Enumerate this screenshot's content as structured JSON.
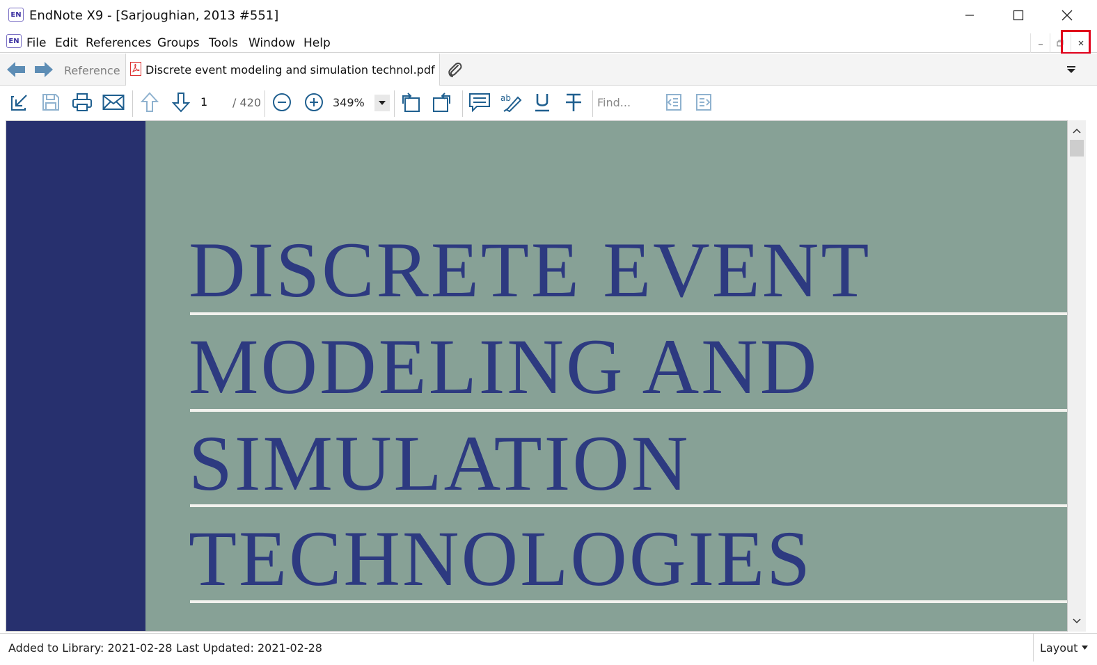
{
  "window": {
    "title": "EndNote X9 - [Sarjoughian, 2013 #551]",
    "app_icon_text": "EN"
  },
  "menu": {
    "items": [
      "File",
      "Edit",
      "References",
      "Groups",
      "Tools",
      "Window",
      "Help"
    ]
  },
  "tabs": {
    "reference_label": "Reference",
    "pdf_label": "Discrete event modeling and simulation technol.pdf"
  },
  "toolbar": {
    "page_current": "1",
    "page_total": "/ 420",
    "zoom": "349%",
    "find_placeholder": "Find..."
  },
  "document": {
    "lines": [
      "DISCRETE EVENT",
      "MODELING AND",
      "SIMULATION",
      "TECHNOLOGIES"
    ],
    "colors": {
      "spine": "#27306e",
      "background": "#87a196",
      "text": "#2d3a80"
    }
  },
  "status": {
    "added": "Added to Library: 2021-02-28",
    "updated": "Last Updated: 2021-02-28",
    "layout": "Layout"
  },
  "colors": {
    "highlight": "#e0001b",
    "icon": "#1f5f8f"
  }
}
